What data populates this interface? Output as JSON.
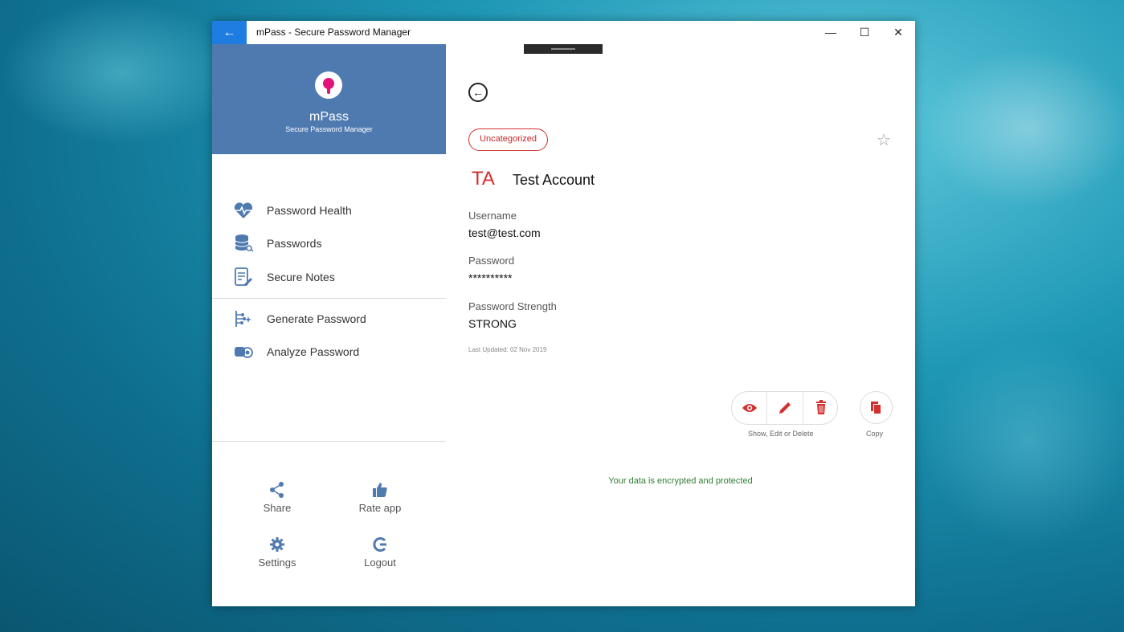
{
  "window": {
    "title": "mPass - Secure Password Manager",
    "back_icon": "arrow-left-icon",
    "minimize_glyph": "—",
    "maximize_glyph": "☐",
    "close_glyph": "✕"
  },
  "sidebar": {
    "brand": {
      "name": "mPass",
      "subtitle": "Secure Password Manager"
    },
    "nav_items": [
      {
        "label": "Password Health",
        "icon": "heartbeat-icon"
      },
      {
        "label": "Passwords",
        "icon": "database-key-icon"
      },
      {
        "label": "Secure Notes",
        "icon": "note-edit-icon"
      },
      {
        "label": "Generate Password",
        "icon": "generate-icon"
      },
      {
        "label": "Analyze Password",
        "icon": "analyze-icon"
      }
    ],
    "actions": [
      {
        "label": "Share",
        "icon": "share-icon"
      },
      {
        "label": "Rate app",
        "icon": "thumbs-up-icon"
      },
      {
        "label": "Settings",
        "icon": "gear-icon"
      },
      {
        "label": "Logout",
        "icon": "logout-icon"
      }
    ],
    "accent_color": "#4f7ab0"
  },
  "detail": {
    "category": "Uncategorized",
    "initials": "TA",
    "account_name": "Test Account",
    "username_label": "Username",
    "username": "test@test.com",
    "password_label": "Password",
    "password": "**********",
    "strength_label": "Password Strength",
    "strength": "STRONG",
    "last_updated": "Last Updated: 02 Nov 2019",
    "actions_label": "Show, Edit  or Delete",
    "copy_label": "Copy",
    "secure_message": "Your data is encrypted and protected",
    "accent_color": "#d32f2f"
  }
}
